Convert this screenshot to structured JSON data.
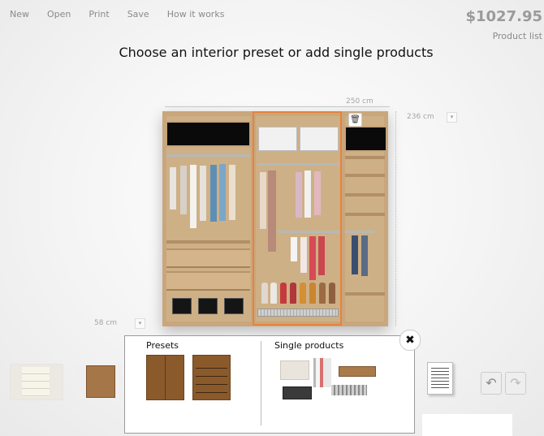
{
  "menu": {
    "new": "New",
    "open": "Open",
    "print": "Print",
    "save": "Save",
    "how": "How it works"
  },
  "price": "$1027.95",
  "product_list": "Product list",
  "title": "Choose an interior preset or add single products",
  "dims": {
    "width": "250 cm",
    "height": "236 cm",
    "depth": "58 cm"
  },
  "panel": {
    "presets_label": "Presets",
    "single_label": "Single products"
  },
  "icons": {
    "trash": "trash-icon",
    "close": "close-icon",
    "undo": "undo-icon",
    "redo": "redo-icon"
  },
  "colors": {
    "selection": "#e8823c",
    "wood": "#c9a67c"
  }
}
